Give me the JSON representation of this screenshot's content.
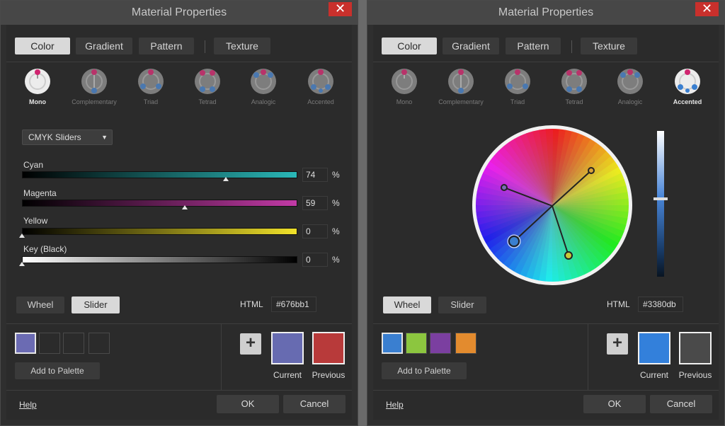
{
  "left": {
    "title": "Material Properties",
    "close": "✕",
    "tabs": [
      "Color",
      "Gradient",
      "Pattern",
      "Texture"
    ],
    "harmonies": [
      "Mono",
      "Complementary",
      "Triad",
      "Tetrad",
      "Analogic",
      "Accented"
    ],
    "active_harmony": "Mono",
    "mode_dropdown": "CMYK Sliders",
    "sliders": [
      {
        "label": "Cyan",
        "value": "74",
        "unit": "%"
      },
      {
        "label": "Magenta",
        "value": "59",
        "unit": "%"
      },
      {
        "label": "Yellow",
        "value": "0",
        "unit": "%"
      },
      {
        "label": "Key (Black)",
        "value": "0",
        "unit": "%"
      }
    ],
    "mode_buttons": [
      "Wheel",
      "Slider"
    ],
    "active_mode": "Slider",
    "html_label": "HTML",
    "html_value": "#676bb1",
    "palette": [
      "#6b6bb3",
      "",
      "",
      ""
    ],
    "add_to_palette": "Add to Palette",
    "current_label": "Current",
    "previous_label": "Previous",
    "current_color": "#676bb1",
    "previous_color": "#b83a3a",
    "help": "Help",
    "ok": "OK",
    "cancel": "Cancel"
  },
  "right": {
    "title": "Material Properties",
    "close": "✕",
    "tabs": [
      "Color",
      "Gradient",
      "Pattern",
      "Texture"
    ],
    "harmonies": [
      "Mono",
      "Complementary",
      "Triad",
      "Tetrad",
      "Analogic",
      "Accented"
    ],
    "active_harmony": "Accented",
    "mode_buttons": [
      "Wheel",
      "Slider"
    ],
    "active_mode": "Wheel",
    "html_label": "HTML",
    "html_value": "#3380db",
    "palette": [
      "#3a7fd0",
      "#8cc63f",
      "#7b3fa0",
      "#e38b2e"
    ],
    "add_to_palette": "Add to Palette",
    "current_label": "Current",
    "previous_label": "Previous",
    "current_color": "#3380db",
    "previous_color": "#4a4a4a",
    "help": "Help",
    "ok": "OK",
    "cancel": "Cancel"
  },
  "icons": {
    "close": "close-icon",
    "plus": "plus-icon",
    "caret": "chevron-down-icon",
    "harmony": "color-harmony-icon"
  },
  "colors": {
    "accent_active_tab": "#d9d9d9",
    "close_button": "#c9302c",
    "panel_bg": "#2b2b2b"
  }
}
